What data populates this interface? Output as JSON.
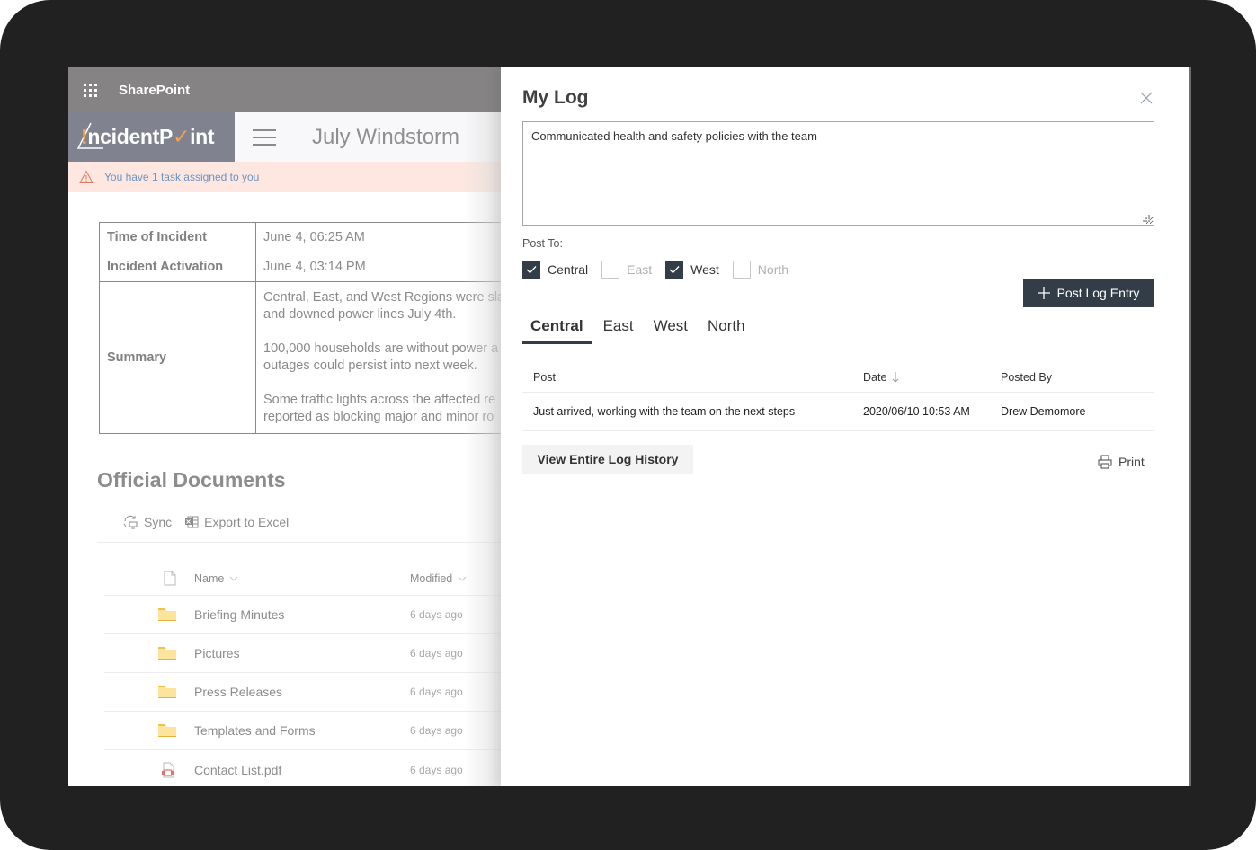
{
  "suitebar": {
    "app_name": "SharePoint",
    "waffle_icon": "app-launcher-icon"
  },
  "site": {
    "logo_text_part1": "!",
    "logo_text_part2": "ncidentP",
    "logo_text_check": "✓",
    "logo_text_part3": "int",
    "title": "July Windstorm",
    "menu_icon": "hamburger-icon"
  },
  "alert": {
    "icon": "warning-icon",
    "text": "You have 1 task assigned to you"
  },
  "incident": {
    "rows": [
      {
        "label": "Time of Incident",
        "value": "June 4, 06:25 AM"
      },
      {
        "label": "Incident Activation",
        "value": "June 4, 03:14 PM"
      }
    ],
    "summary_label": "Summary",
    "summary_paragraphs": [
      "Central, East, and West Regions were sla",
      "and downed power lines July 4th.",
      "100,000 households are without power a",
      "outages could persist into next week.",
      "Some traffic lights across the affected re",
      "reported as blocking major and minor ro"
    ]
  },
  "documents": {
    "title": "Official Documents",
    "commands": {
      "sync": "Sync",
      "export": "Export to Excel"
    },
    "columns": {
      "name": "Name",
      "modified": "Modified"
    },
    "items": [
      {
        "type": "folder",
        "name": "Briefing Minutes",
        "modified": "6 days ago"
      },
      {
        "type": "folder",
        "name": "Pictures",
        "modified": "6 days ago"
      },
      {
        "type": "folder",
        "name": "Press Releases",
        "modified": "6 days ago"
      },
      {
        "type": "folder",
        "name": "Templates and Forms",
        "modified": "6 days ago"
      },
      {
        "type": "pdf",
        "name": "Contact List.pdf",
        "modified": "6 days ago"
      }
    ]
  },
  "panel": {
    "title": "My Log",
    "entry_value": "Communicated health and safety policies with the team",
    "post_to_label": "Post To:",
    "regions": [
      {
        "label": "Central",
        "checked": true
      },
      {
        "label": "East",
        "checked": false
      },
      {
        "label": "West",
        "checked": true
      },
      {
        "label": "North",
        "checked": false
      }
    ],
    "post_button": "Post Log Entry",
    "tabs": [
      {
        "label": "Central",
        "active": true
      },
      {
        "label": "East",
        "active": false
      },
      {
        "label": "West",
        "active": false
      },
      {
        "label": "North",
        "active": false
      }
    ],
    "log_columns": {
      "post": "Post",
      "date": "Date",
      "posted_by": "Posted By"
    },
    "log_entries": [
      {
        "post": "Just arrived, working with the team on the next steps",
        "date": "2020/06/10 10:53 AM",
        "posted_by": "Drew Demomore"
      }
    ],
    "view_history_button": "View Entire Log History",
    "print_label": "Print"
  },
  "colors": {
    "suitebar": "#858383",
    "logo_bg": "#80838f",
    "logo_accent": "#f3a34a",
    "alert_bg": "#fde7e0",
    "primary_dark": "#323d47"
  }
}
